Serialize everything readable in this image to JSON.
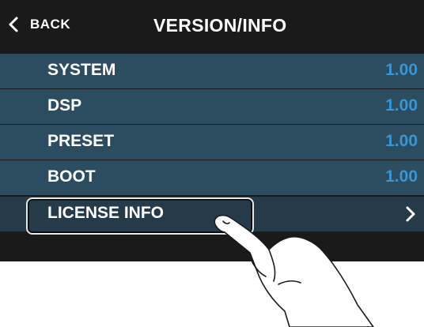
{
  "header": {
    "back_label": "BACK",
    "title": "VERSION/INFO"
  },
  "rows": [
    {
      "label": "SYSTEM",
      "value": "1.00"
    },
    {
      "label": "DSP",
      "value": "1.00"
    },
    {
      "label": "PRESET",
      "value": "1.00"
    },
    {
      "label": "BOOT",
      "value": "1.00"
    }
  ],
  "license": {
    "label": "LICENSE INFO",
    "icon": "chevron-right-icon"
  },
  "colors": {
    "row_bg": "#2c4c60",
    "value_text": "#3a95d2",
    "screen_bg": "#1a1a1a"
  }
}
